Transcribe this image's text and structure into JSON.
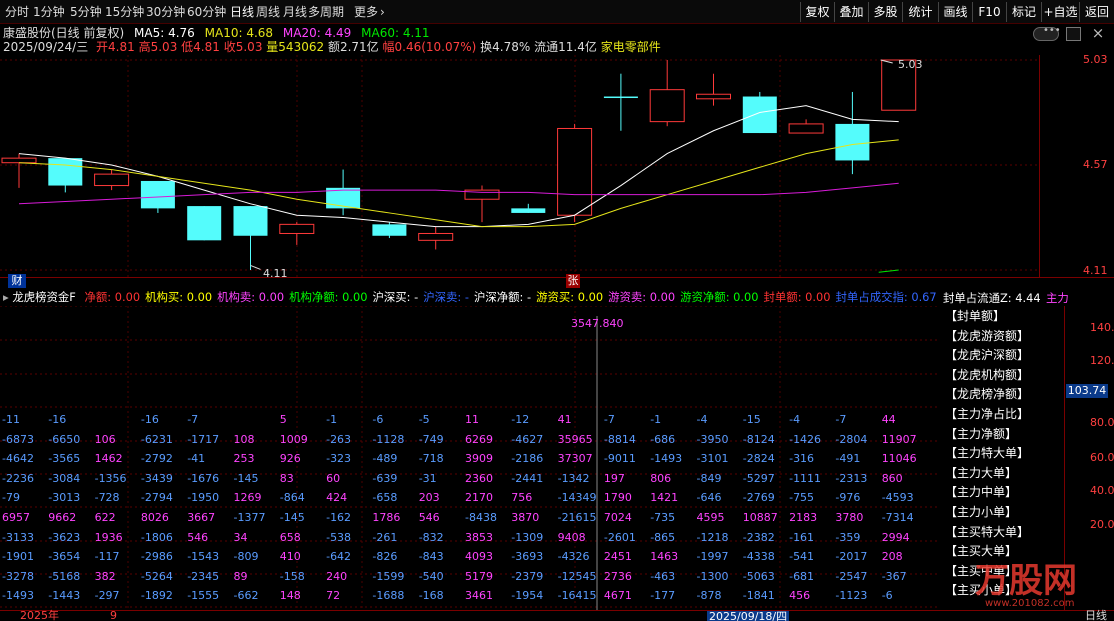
{
  "toolbar": {
    "tabs": [
      "分时",
      "1分钟",
      "5分钟",
      "15分钟",
      "30分钟",
      "60分钟",
      "日线",
      "周线",
      "月线",
      "多周期",
      "更多"
    ],
    "more_arrow": "›",
    "right": [
      "复权",
      "叠加",
      "多股",
      "统计",
      "画线",
      "F10",
      "标记",
      "+自选",
      "返回"
    ]
  },
  "info": {
    "stock": "康盛股份(日线 前复权)",
    "ma5": "MA5: 4.76",
    "ma10": "MA10: 4.68",
    "ma20": "MA20: 4.49",
    "ma60": "MA60: 4.11",
    "date": "2025/09/24/三",
    "open": "开4.81",
    "high": "高5.03",
    "low": "低4.81",
    "close": "收5.03",
    "vol": "量543062",
    "amt": "额2.71亿",
    "amp": "幅0.46(10.07%)",
    "turn": "换4.78%",
    "float": "流通11.4亿",
    "sector": "家电零部件"
  },
  "price_axis": {
    "top": "5.03",
    "mid": "4.57",
    "bot": "4.11"
  },
  "markers": {
    "high_label": "5.03",
    "low_label": "4.11",
    "cai": "财",
    "zhang": "张"
  },
  "candles": [
    {
      "o": 4.6,
      "c": 4.58,
      "h": 4.62,
      "l": 4.47,
      "up": true
    },
    {
      "o": 4.6,
      "c": 4.48,
      "h": 4.6,
      "l": 4.45,
      "up": false
    },
    {
      "o": 4.53,
      "c": 4.48,
      "h": 4.55,
      "l": 4.46,
      "up": true
    },
    {
      "o": 4.5,
      "c": 4.38,
      "h": 4.5,
      "l": 4.36,
      "up": false
    },
    {
      "o": 4.39,
      "c": 4.24,
      "h": 4.39,
      "l": 4.24,
      "up": false
    },
    {
      "o": 4.39,
      "c": 4.26,
      "h": 4.39,
      "l": 4.11,
      "up": false
    },
    {
      "o": 4.27,
      "c": 4.31,
      "h": 4.32,
      "l": 4.22,
      "up": true
    },
    {
      "o": 4.47,
      "c": 4.38,
      "h": 4.55,
      "l": 4.35,
      "up": false
    },
    {
      "o": 4.31,
      "c": 4.26,
      "h": 4.32,
      "l": 4.25,
      "up": false
    },
    {
      "o": 4.24,
      "c": 4.27,
      "h": 4.3,
      "l": 4.2,
      "up": true
    },
    {
      "o": 4.42,
      "c": 4.46,
      "h": 4.48,
      "l": 4.32,
      "up": true
    },
    {
      "o": 4.38,
      "c": 4.36,
      "h": 4.4,
      "l": 4.36,
      "up": false
    },
    {
      "o": 4.35,
      "c": 4.73,
      "h": 4.75,
      "l": 4.32,
      "up": true
    },
    {
      "o": 4.87,
      "c": 4.87,
      "h": 4.97,
      "l": 4.72,
      "up": false
    },
    {
      "o": 4.76,
      "c": 4.9,
      "h": 5.03,
      "l": 4.74,
      "up": true
    },
    {
      "o": 4.86,
      "c": 4.88,
      "h": 4.97,
      "l": 4.83,
      "up": true
    },
    {
      "o": 4.87,
      "c": 4.71,
      "h": 4.89,
      "l": 4.71,
      "up": false
    },
    {
      "o": 4.71,
      "c": 4.75,
      "h": 4.77,
      "l": 4.71,
      "up": true
    },
    {
      "o": 4.75,
      "c": 4.59,
      "h": 4.89,
      "l": 4.53,
      "up": false
    },
    {
      "o": 4.81,
      "c": 5.03,
      "h": 5.03,
      "l": 4.81,
      "up": true
    }
  ],
  "ma_lines": {
    "ma5": [
      4.62,
      4.6,
      4.57,
      4.52,
      4.46,
      4.4,
      4.35,
      4.34,
      4.32,
      4.3,
      4.3,
      4.31,
      4.35,
      4.48,
      4.62,
      4.72,
      4.8,
      4.83,
      4.77,
      4.76
    ],
    "ma10": [
      4.58,
      4.57,
      4.55,
      4.52,
      4.49,
      4.46,
      4.42,
      4.39,
      4.36,
      4.33,
      4.3,
      4.3,
      4.31,
      4.38,
      4.44,
      4.5,
      4.56,
      4.62,
      4.66,
      4.68
    ],
    "ma20": [
      4.4,
      4.41,
      4.42,
      4.43,
      4.44,
      4.45,
      4.45,
      4.46,
      4.46,
      4.46,
      4.45,
      4.45,
      4.44,
      4.44,
      4.44,
      4.44,
      4.44,
      4.45,
      4.47,
      4.49
    ],
    "ma60": [
      4.15,
      4.11
    ]
  },
  "lower": {
    "indicator_name": "龙虎榜资金F",
    "legend": [
      {
        "text": "净额: 0.00",
        "color": "#ff3333"
      },
      {
        "text": "机构买: 0.00",
        "color": "#ffff00"
      },
      {
        "text": "机构卖: 0.00",
        "color": "#ff44ff"
      },
      {
        "text": "机构净额: 0.00",
        "color": "#00ff00"
      },
      {
        "text": "沪深买: -",
        "color": "#ffffff"
      },
      {
        "text": "沪深卖: -",
        "color": "#3366ff"
      },
      {
        "text": "沪深净额: -",
        "color": "#ffffff"
      },
      {
        "text": "游资买: 0.00",
        "color": "#ffff00"
      },
      {
        "text": "游资卖: 0.00",
        "color": "#ff44ff"
      },
      {
        "text": "游资净额: 0.00",
        "color": "#00ff00"
      },
      {
        "text": "封单额: 0.00",
        "color": "#ff3333"
      },
      {
        "text": "封单占成交指: 0.67",
        "color": "#3366ff"
      }
    ],
    "right_legend": "封单占流通Z: 4.44",
    "right_legend2": "主力",
    "peak_label": "3547.840",
    "axis": {
      "a": "140.00",
      "b": "120.00",
      "c": "103.74",
      "d": "80.00",
      "e": "60.00",
      "f": "40.00",
      "g": "20.00"
    },
    "side_items": [
      "【封单额】",
      "【龙虎游资额】",
      "【龙虎沪深额】",
      "【龙虎机构额】",
      "【龙虎榜净额】",
      "【主力净占比】",
      "【主力净额】",
      "【主力特大单】",
      "【主力大单】",
      "【主力中单】",
      "【主力小单】",
      "【主买特大单】",
      "【主买大单】",
      "【主买中单】",
      "【主买小单】"
    ],
    "rows": [
      [
        "-11",
        "-16",
        "",
        "-16",
        "-7",
        "",
        "5",
        "-1",
        "-6",
        "-5",
        "11",
        "-12",
        "41",
        "-7",
        "-1",
        "-4",
        "-15",
        "-4",
        "-7",
        "44"
      ],
      [
        "-6873",
        "-6650",
        "106",
        "-6231",
        "-1717",
        "108",
        "1009",
        "-263",
        "-1128",
        "-749",
        "6269",
        "-4627",
        "35965",
        "-8814",
        "-686",
        "-3950",
        "-8124",
        "-1426",
        "-2804",
        "11907"
      ],
      [
        "-4642",
        "-3565",
        "1462",
        "-2792",
        "-41",
        "253",
        "926",
        "-323",
        "-489",
        "-718",
        "3909",
        "-2186",
        "37307",
        "-9011",
        "-1493",
        "-3101",
        "-2824",
        "-316",
        "-491",
        "11046"
      ],
      [
        "-2236",
        "-3084",
        "-1356",
        "-3439",
        "-1676",
        "-145",
        "83",
        "60",
        "-639",
        "-31",
        "2360",
        "-2441",
        "-1342",
        "197",
        "806",
        "-849",
        "-5297",
        "-1111",
        "-2313",
        "860"
      ],
      [
        "-79",
        "-3013",
        "-728",
        "-2794",
        "-1950",
        "1269",
        "-864",
        "424",
        "-658",
        "203",
        "2170",
        "756",
        "-14349",
        "1790",
        "1421",
        "-646",
        "-2769",
        "-755",
        "-976",
        "-4593"
      ],
      [
        "6957",
        "9662",
        "622",
        "8026",
        "3667",
        "-1377",
        "-145",
        "-162",
        "1786",
        "546",
        "-8438",
        "3870",
        "-21615",
        "7024",
        "-735",
        "4595",
        "10887",
        "2183",
        "3780",
        "-7314"
      ],
      [
        "-3133",
        "-3623",
        "1936",
        "-1806",
        "546",
        "34",
        "658",
        "-538",
        "-261",
        "-832",
        "3853",
        "-1309",
        "9408",
        "-2601",
        "-865",
        "-1218",
        "-2382",
        "-161",
        "-359",
        "2994"
      ],
      [
        "-1901",
        "-3654",
        "-117",
        "-2986",
        "-1543",
        "-809",
        "410",
        "-642",
        "-826",
        "-843",
        "4093",
        "-3693",
        "-4326",
        "2451",
        "1463",
        "-1997",
        "-4338",
        "-541",
        "-2017",
        "208"
      ],
      [
        "-3278",
        "-5168",
        "382",
        "-5264",
        "-2345",
        "89",
        "-158",
        "240",
        "-1599",
        "-540",
        "5179",
        "-2379",
        "-12545",
        "2736",
        "-463",
        "-1300",
        "-5063",
        "-681",
        "-2547",
        "-367"
      ],
      [
        "-1493",
        "-1443",
        "-297",
        "-1892",
        "-1555",
        "-662",
        "148",
        "72",
        "-1688",
        "-168",
        "3461",
        "-1954",
        "-16415",
        "4671",
        "-177",
        "-878",
        "-1841",
        "456",
        "-1123",
        "-6"
      ]
    ]
  },
  "bottom": {
    "year": "2025年",
    "month": "9",
    "cursor_date": "2025/09/18/四",
    "period": "日线"
  },
  "colors": {
    "up": "#ff3a3a",
    "down": "#54fcfc",
    "ma5": "#ffffff",
    "ma10": "#e5e51a",
    "ma20": "#d81bd8",
    "ma60": "#00e800",
    "pos": "#ff44ff",
    "neg": "#5a9cff"
  }
}
